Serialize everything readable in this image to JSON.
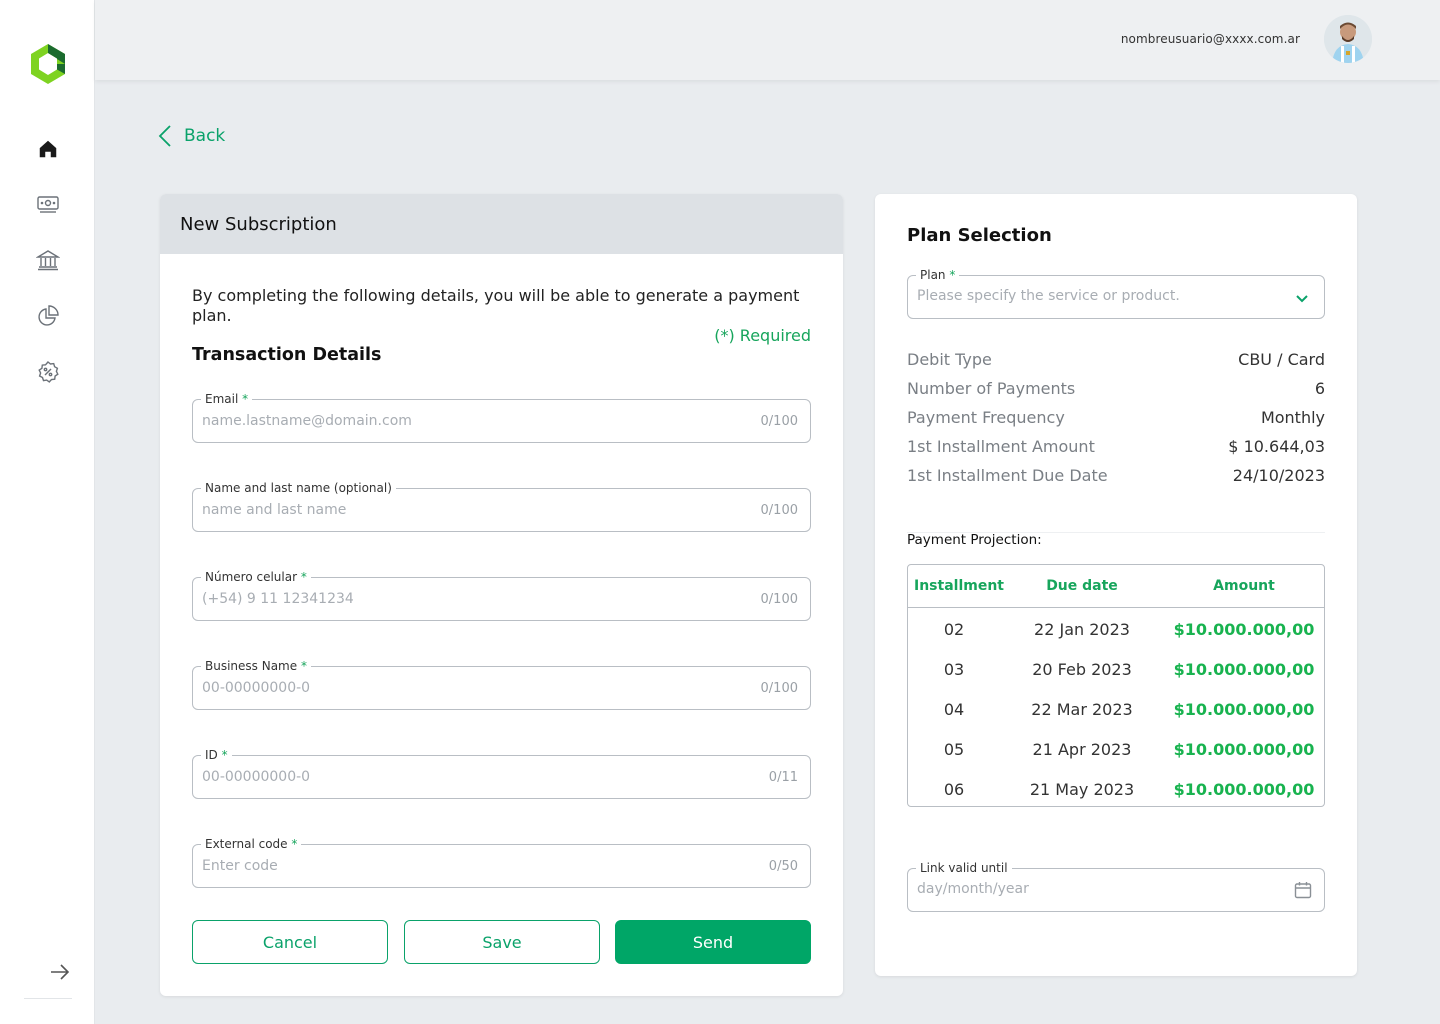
{
  "header": {
    "user_email": "nombreusuario@xxxx.com.ar"
  },
  "sidebar": {
    "items": [
      {
        "icon": "home-icon"
      },
      {
        "icon": "money-icon"
      },
      {
        "icon": "bank-icon"
      },
      {
        "icon": "pie-chart-icon"
      },
      {
        "icon": "discount-icon"
      }
    ],
    "collapse_icon": "arrow-right-icon"
  },
  "back_label": "Back",
  "subscription": {
    "title": "New Subscription",
    "intro": "By completing the following details, you will be able to generate a payment plan.",
    "required_note": "(*) Required",
    "section_title": "Transaction Details",
    "fields": [
      {
        "label": "Email",
        "required": "*",
        "placeholder": "name.lastname@domain.com",
        "counter": "0/100"
      },
      {
        "label": "Name and last name (optional)",
        "required": "",
        "placeholder": "name and last name",
        "counter": "0/100"
      },
      {
        "label": "Número celular",
        "required": "*",
        "placeholder": "(+54) 9 11 12341234",
        "counter": "0/100"
      },
      {
        "label": "Business Name",
        "required": "*",
        "placeholder": "00-00000000-0",
        "counter": "0/100"
      },
      {
        "label": "ID",
        "required": "*",
        "placeholder": "00-00000000-0",
        "counter": "0/11"
      },
      {
        "label": "External code",
        "required": "*",
        "placeholder": "Enter code",
        "counter": "0/50"
      }
    ],
    "buttons": {
      "cancel": "Cancel",
      "save": "Save",
      "send": "Send"
    }
  },
  "plan": {
    "title": "Plan Selection",
    "select_label": "Plan",
    "select_required": "*",
    "select_placeholder": "Please specify the service or product.",
    "summary": [
      {
        "key": "Debit Type",
        "value": "CBU / Card"
      },
      {
        "key": "Number of Payments",
        "value": "6"
      },
      {
        "key": "Payment Frequency",
        "value": "Monthly"
      },
      {
        "key": "1st Installment Amount",
        "value": "$ 10.644,03"
      },
      {
        "key": "1st Installment Due Date",
        "value": "24/10/2023"
      }
    ],
    "projection_label": "Payment Projection:",
    "table": {
      "headers": [
        "Installment",
        "Due date",
        "Amount"
      ],
      "rows": [
        [
          "02",
          "22 Jan 2023",
          "$10.000.000,00"
        ],
        [
          "03",
          "20 Feb 2023",
          "$10.000.000,00"
        ],
        [
          "04",
          "22 Mar 2023",
          "$10.000.000,00"
        ],
        [
          "05",
          "21 Apr 2023",
          "$10.000.000,00"
        ],
        [
          "06",
          "21 May 2023",
          "$10.000.000,00"
        ]
      ]
    },
    "link_label": "Link valid until",
    "link_placeholder": "day/month/year"
  },
  "colors": {
    "accent": "#00a667",
    "accent_text": "#0aa26a",
    "amount": "#18b34f"
  }
}
